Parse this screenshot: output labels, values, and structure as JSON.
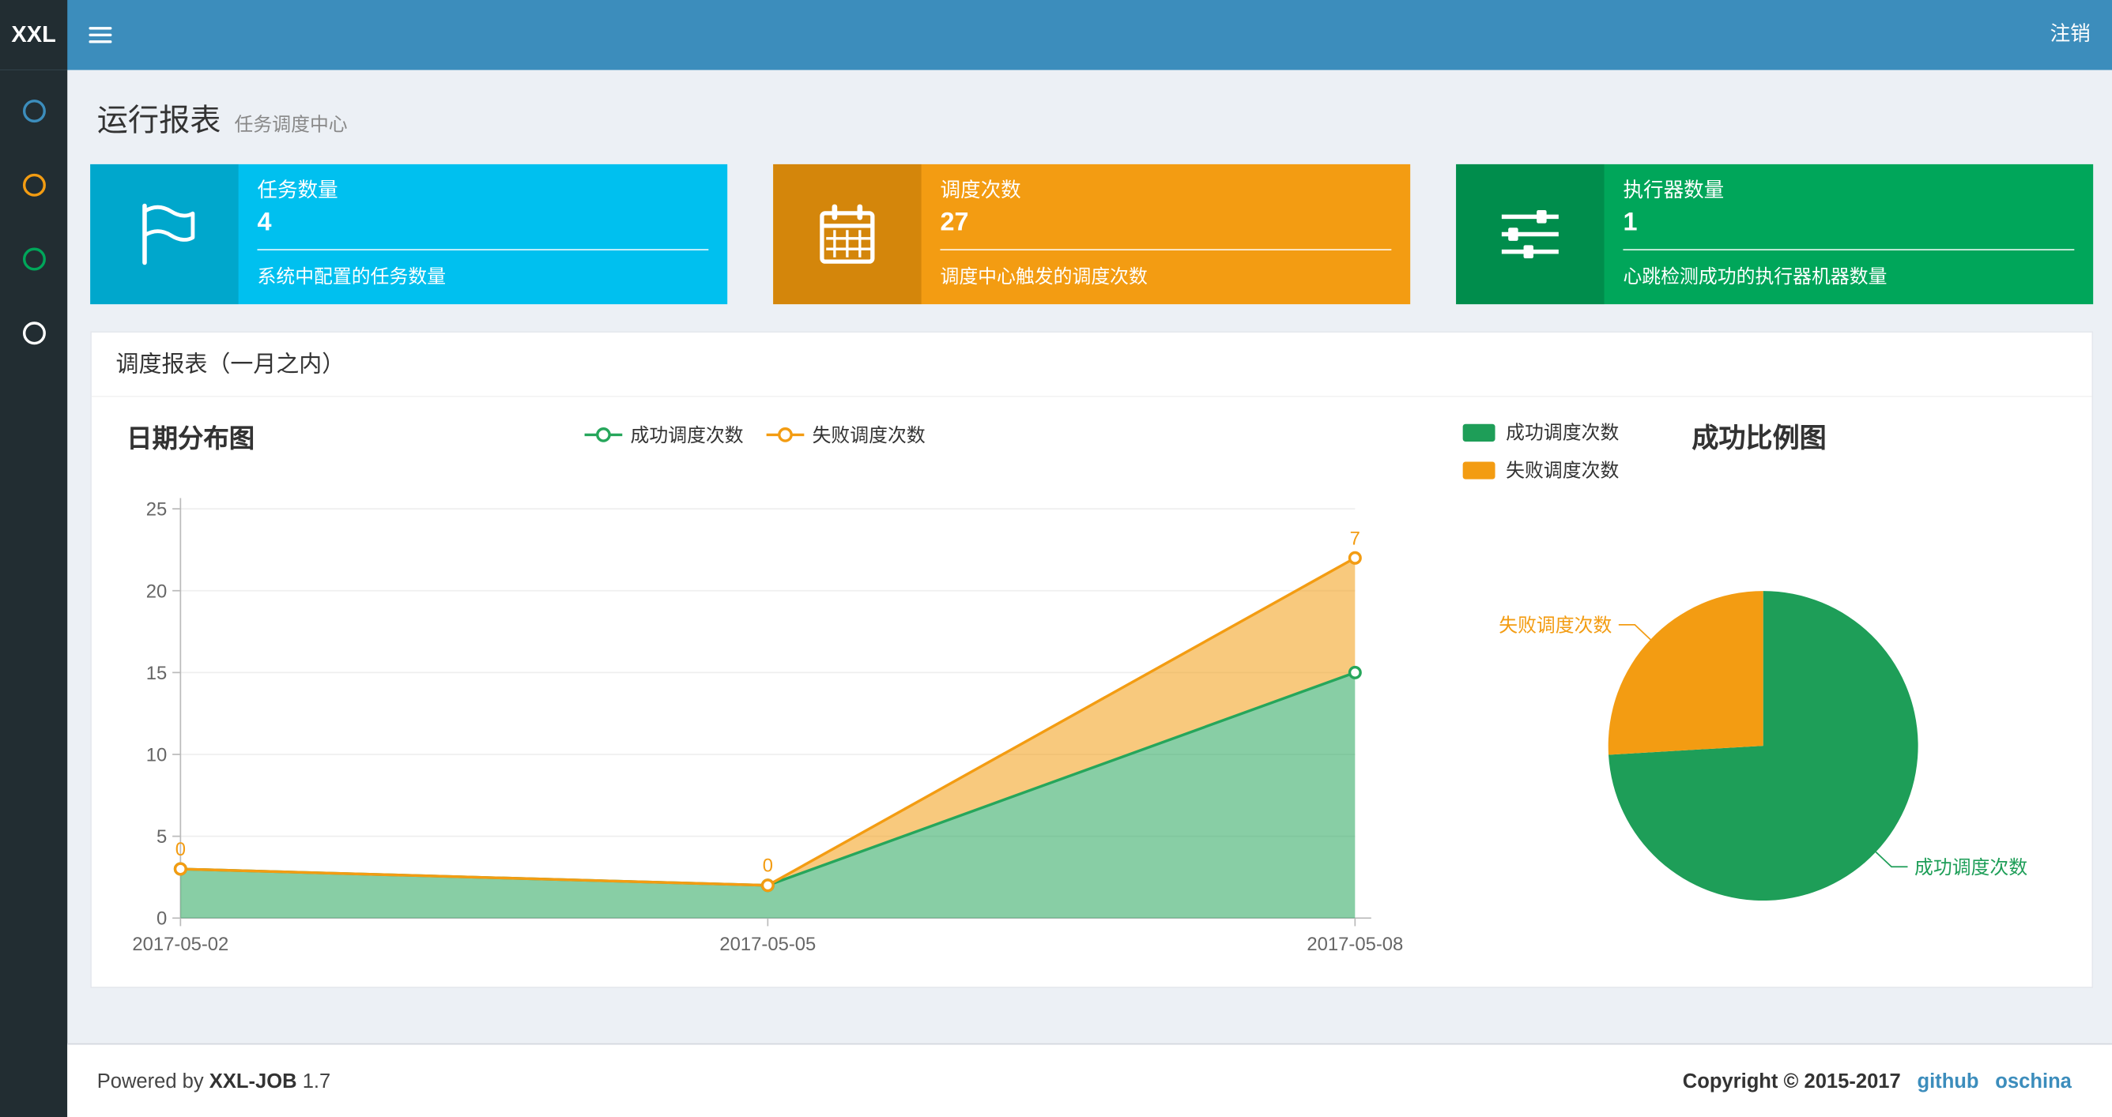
{
  "navbar": {
    "logo": "XXL",
    "logout": "注销"
  },
  "sidebar": {
    "items": [
      {
        "name": "menu-report",
        "icon": "circle-icon",
        "color": "#3c8dbc"
      },
      {
        "name": "menu-job",
        "icon": "circle-icon",
        "color": "#f39c12"
      },
      {
        "name": "menu-executor",
        "icon": "circle-icon",
        "color": "#00a65a"
      },
      {
        "name": "menu-help",
        "icon": "circle-icon",
        "color": "#ffffff"
      }
    ]
  },
  "page": {
    "title": "运行报表",
    "subtitle": "任务调度中心"
  },
  "info_boxes": [
    {
      "title": "任务数量",
      "value": "4",
      "desc": "系统中配置的任务数量",
      "color": "#00c0ef",
      "icon_color": "#00a7cc",
      "icon": "flag-icon"
    },
    {
      "title": "调度次数",
      "value": "27",
      "desc": "调度中心触发的调度次数",
      "color": "#f39c12",
      "icon_color": "#d4860b",
      "icon": "calendar-icon"
    },
    {
      "title": "执行器数量",
      "value": "1",
      "desc": "心跳检测成功的执行器机器数量",
      "color": "#00a65a",
      "icon_color": "#008d4c",
      "icon": "sliders-icon"
    }
  ],
  "panel": {
    "title": "调度报表（一月之内）"
  },
  "chart_data": [
    {
      "type": "area",
      "title": "日期分布图",
      "x": [
        "2017-05-02",
        "2017-05-05",
        "2017-05-08"
      ],
      "series": [
        {
          "name": "成功调度次数",
          "values": [
            3,
            2,
            15
          ],
          "color": "#26a65b"
        },
        {
          "name": "失败调度次数",
          "values": [
            0,
            0,
            7
          ],
          "color": "#f39c12",
          "labels": [
            "0",
            "0",
            "7"
          ]
        }
      ],
      "stacked": true,
      "ylim": [
        0,
        25
      ],
      "yticks": [
        0,
        5,
        10,
        15,
        20,
        25
      ],
      "grid": true,
      "legend_position": "top"
    },
    {
      "type": "pie",
      "title": "成功比例图",
      "slices": [
        {
          "name": "成功调度次数",
          "value": 20,
          "color": "#1e9e58"
        },
        {
          "name": "失败调度次数",
          "value": 7,
          "color": "#f39c12"
        }
      ],
      "total": 27,
      "legend_position": "top-left"
    }
  ],
  "footer": {
    "powered": "Powered by",
    "brand": "XXL-JOB",
    "version": "1.7",
    "copyright": "Copyright © 2015-2017",
    "links": [
      {
        "label": "github"
      },
      {
        "label": "oschina"
      }
    ]
  }
}
